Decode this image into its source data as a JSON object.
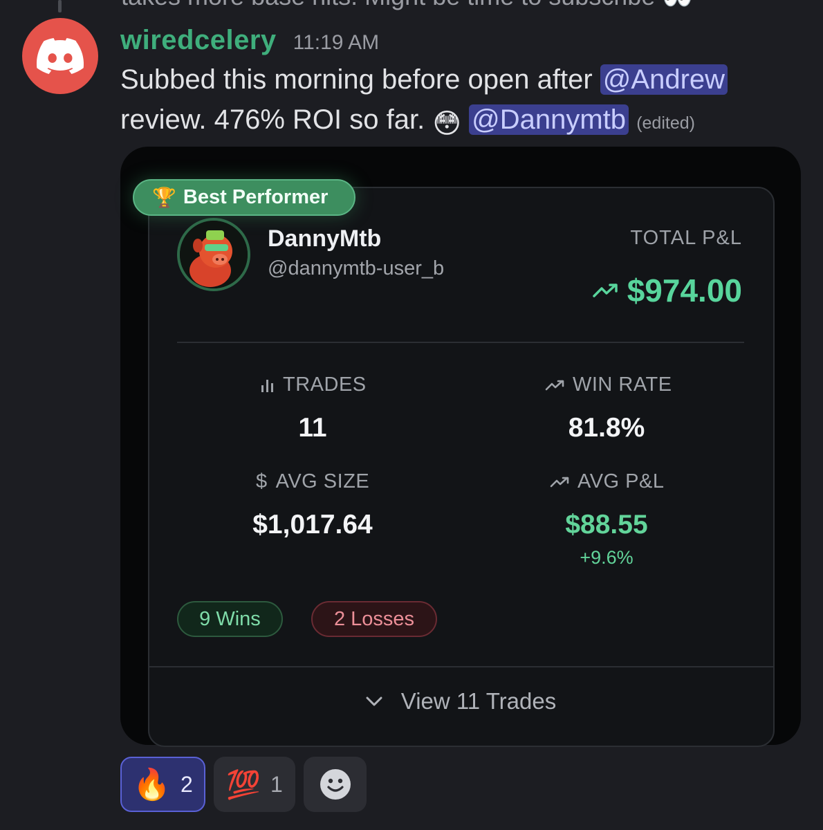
{
  "previous_message": {
    "text": "takes more base hits. Might be time to subscribe 👀"
  },
  "message": {
    "author": "wiredcelery",
    "timestamp": "11:19 AM",
    "text_part1": "Subbed this morning before open after ",
    "mention1": "@Andrew",
    "text_part2": " review. 476% ROI so far. ",
    "emoji": "😳",
    "mention2": "@Dannymtb",
    "edited": "(edited)"
  },
  "card": {
    "badge": "Best Performer",
    "badge_icon": "🏆",
    "trader_name": "DannyMtb",
    "trader_handle": "@dannymtb-user_b",
    "pnl_label": "TOTAL P&L",
    "pnl_value": "$974.00",
    "stats": {
      "trades_label": "TRADES",
      "trades_value": "11",
      "win_rate_label": "WIN RATE",
      "win_rate_value": "81.8%",
      "avg_size_label": "AVG SIZE",
      "avg_size_value": "$1,017.64",
      "avg_pnl_label": "AVG P&L",
      "avg_pnl_value": "$88.55",
      "avg_pnl_pct": "+9.6%"
    },
    "wins": "9 Wins",
    "losses": "2 Losses",
    "view_trades": "View 11 Trades"
  },
  "reactions": [
    {
      "emoji": "🔥",
      "count": "2"
    },
    {
      "emoji": "💯",
      "count": "1"
    },
    {
      "emoji": "add-reaction-icon"
    }
  ],
  "colors": {
    "username": "#3fae7c",
    "mention_bg": "#3b3f8f",
    "positive": "#58d59c",
    "negative": "#ec8f98",
    "discord_avatar": "#e5534b"
  }
}
